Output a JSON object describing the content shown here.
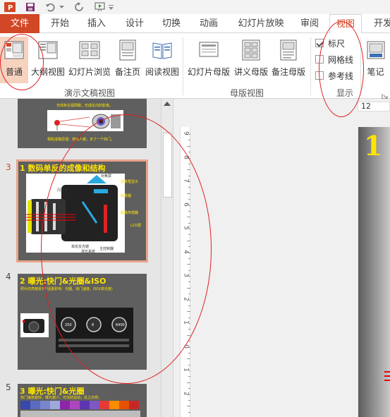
{
  "tabs": [
    {
      "label": "文件"
    },
    {
      "label": "开始"
    },
    {
      "label": "插入"
    },
    {
      "label": "设计"
    },
    {
      "label": "切换"
    },
    {
      "label": "动画"
    },
    {
      "label": "幻灯片放映"
    },
    {
      "label": "审阅"
    },
    {
      "label": "视图"
    },
    {
      "label": "开发"
    }
  ],
  "ribbon": {
    "presentation_views": {
      "buttons": [
        {
          "label": "普通"
        },
        {
          "label": "大纲视图"
        },
        {
          "label": "幻灯片浏览"
        },
        {
          "label": "备注页"
        },
        {
          "label": "阅读视图"
        }
      ],
      "group_label": "演示文稿视图"
    },
    "master_views": {
      "buttons": [
        {
          "label": "幻灯片母版"
        },
        {
          "label": "讲义母版"
        },
        {
          "label": "备注母版"
        }
      ],
      "group_label": "母版视图"
    },
    "show": {
      "checkboxes": [
        {
          "label": "标尺",
          "checked": true
        },
        {
          "label": "网格线",
          "checked": false
        },
        {
          "label": "参考线",
          "checked": false
        }
      ],
      "group_label": "显示"
    },
    "notes_label": "笔记"
  },
  "zoom_field": "12",
  "slides": [
    {
      "number": "",
      "text_top": "光线条在视网膜，形成反向的影像。",
      "text_bottom": "相机成像原理：类似人眼，多了一个快门。"
    },
    {
      "number": "3",
      "title": "1 数码单反的成像和结构",
      "labels": [
        "闪光灯",
        "对焦屏",
        "观景框显示",
        "取景器",
        "图像传感器",
        "LCD屏",
        "单反反光镜",
        "测光系统",
        "主控制器"
      ]
    },
    {
      "number": "4",
      "title": "2 曝光:快门&光圈&ISO",
      "subtitle": "照片的亮暗受3个因素影响：光圈、快门速度、ISO(感光度)",
      "dials": [
        "250",
        "8",
        "6400"
      ]
    },
    {
      "number": "5",
      "title": "3 曝光:快门&光圈",
      "subtitle": "快门速度越快，曝光越少，可冻结运动；反之亦然。"
    }
  ],
  "ruler_numbers": [
    "9",
    "8",
    "7",
    "6",
    "5",
    "4",
    "3",
    "2",
    "1",
    "0",
    "1",
    "2"
  ],
  "slide_big_number": "1",
  "colors": {
    "accent": "#d24726",
    "annotation": "#e02020",
    "slide_title": "#ffe500"
  }
}
